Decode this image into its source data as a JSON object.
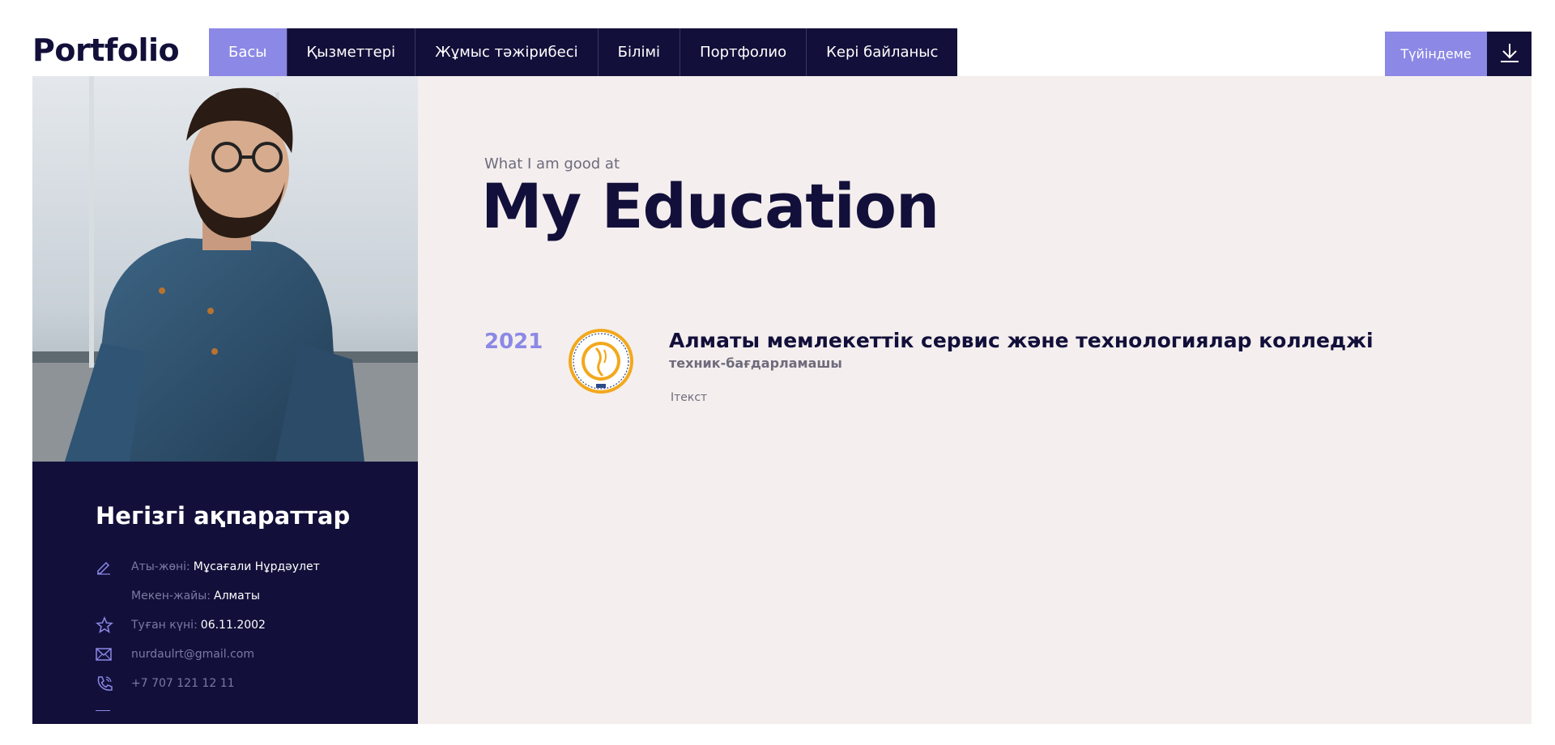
{
  "header": {
    "logo": "Portfolio",
    "nav": [
      {
        "label": "Басы",
        "active": true
      },
      {
        "label": "Қызметтері",
        "active": false
      },
      {
        "label": "Жұмыс тәжірибесі",
        "active": false
      },
      {
        "label": "Білімі",
        "active": false
      },
      {
        "label": "Портфолио",
        "active": false
      },
      {
        "label": "Кері байланыс",
        "active": false
      }
    ],
    "cv_button": "Түйіндеме",
    "download_icon": "download-icon"
  },
  "sidebar": {
    "photo_alt": "profile-photo",
    "title": "Негізгі ақпараттар",
    "name_label": "Аты-жөні:",
    "name_value": "Мұсағали Нұрдәулет",
    "address_label": "Мекен-жайы:",
    "address_value": "Алматы",
    "birth_label": "Туған күні:",
    "birth_value": "06.11.2002",
    "email": "nurdaulrt@gmail.com",
    "phone": "+7 707 121 12 11"
  },
  "main": {
    "subtitle": "What I am good at",
    "title": "My Education",
    "education": [
      {
        "year": "2021",
        "school": "Алматы мемлекеттік сервис және технологиялар колледжі",
        "degree": "техник-бағдарламашы",
        "text": "Ітекст"
      }
    ]
  },
  "colors": {
    "navy": "#12103a",
    "accent": "#8b88e6",
    "content_bg": "#f4eeee"
  }
}
